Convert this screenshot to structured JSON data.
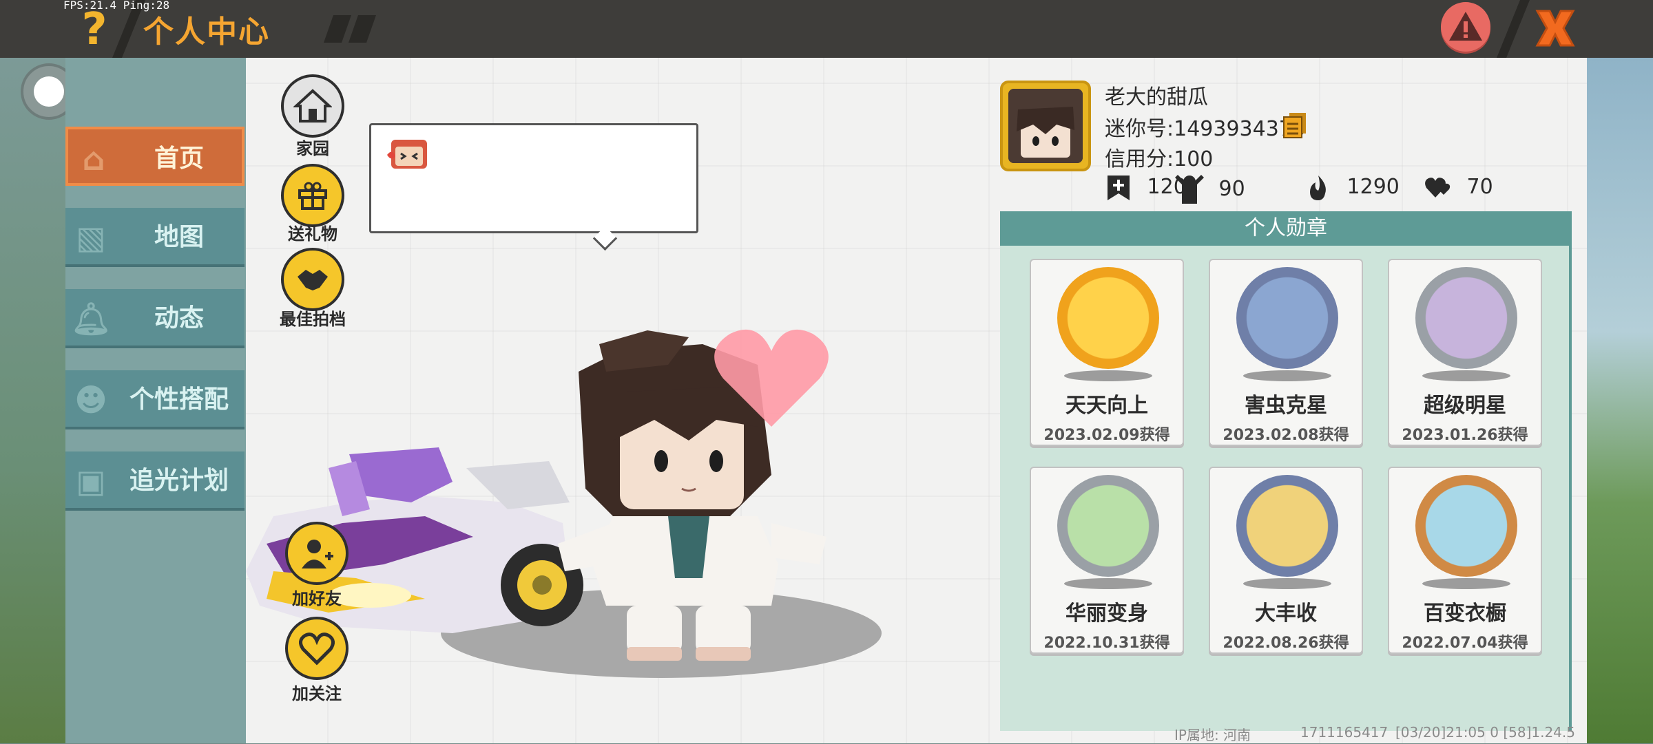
{
  "debug": {
    "fps_text": "FPS:21.4  Ping:28"
  },
  "header": {
    "title": "个人中心",
    "help_icon": "question-mark-icon",
    "warn_icon": "warning-icon",
    "close_icon": "close-x-icon"
  },
  "sidebar": {
    "items": [
      {
        "label": "首页",
        "icon": "house-icon",
        "active": true
      },
      {
        "label": "地图",
        "icon": "map-icon",
        "active": false
      },
      {
        "label": "动态",
        "icon": "bell-icon",
        "active": false
      },
      {
        "label": "个性搭配",
        "icon": "character-icon",
        "active": false
      },
      {
        "label": "追光计划",
        "icon": "plan-icon",
        "active": false
      }
    ]
  },
  "actions": {
    "home": "家园",
    "gift": "送礼物",
    "partner": "最佳拍档",
    "add_friend": "加好友",
    "follow": "加关注"
  },
  "profile": {
    "name": "老大的甜瓜",
    "mini_id": "迷你号:1493934376",
    "credit": "信用分:100",
    "stats": {
      "added": "120",
      "fans": "90",
      "heat": "1290",
      "likes": "70"
    }
  },
  "medals": {
    "title": "个人勋章",
    "items": [
      {
        "name": "天天向上",
        "date": "2023.02.09获得",
        "color": "#f0a21c"
      },
      {
        "name": "害虫克星",
        "date": "2023.02.08获得",
        "color": "#6f7fa8"
      },
      {
        "name": "超级明星",
        "date": "2023.01.26获得",
        "color": "#9aa0a6"
      },
      {
        "name": "华丽变身",
        "date": "2022.10.31获得",
        "color": "#9aa0a6"
      },
      {
        "name": "大丰收",
        "date": "2022.08.26获得",
        "color": "#6f7fa8"
      },
      {
        "name": "百变衣橱",
        "date": "2022.07.04获得",
        "color": "#d08a45"
      }
    ]
  },
  "footer": {
    "ip": "IP属地: 河南",
    "uid": "1711165417",
    "time": "[03/20]21:05 0  [58]1.24.5"
  }
}
